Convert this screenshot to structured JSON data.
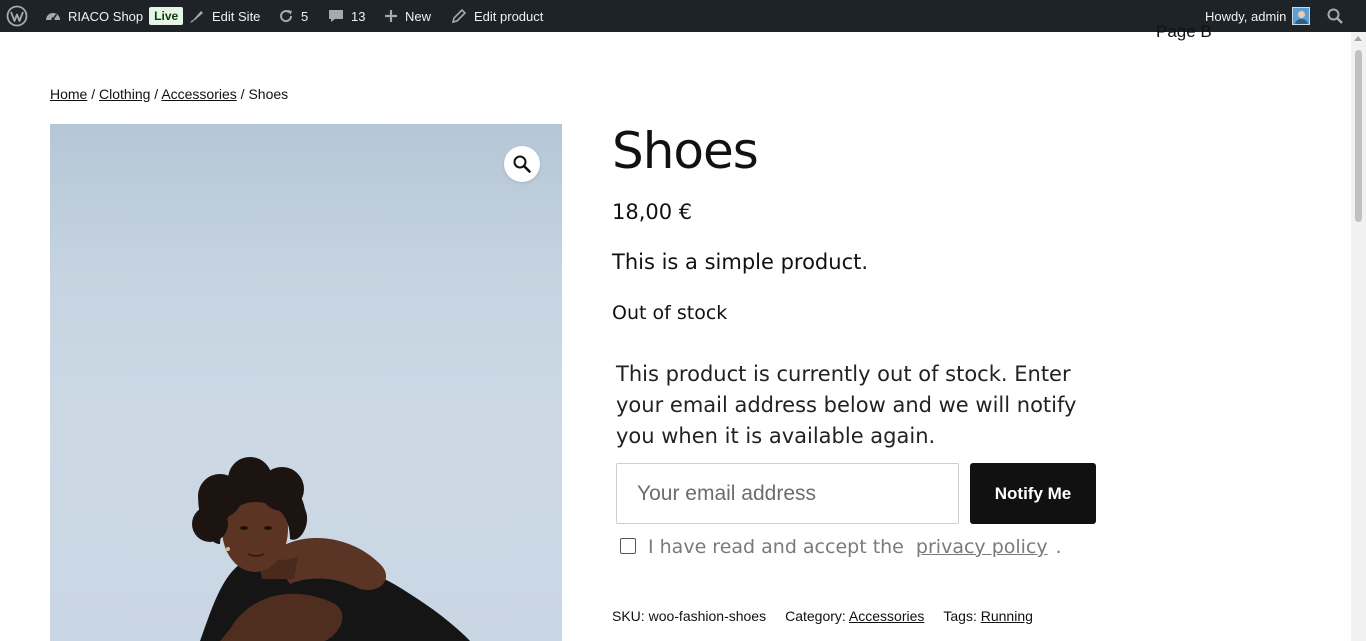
{
  "admin_bar": {
    "site_name": "RIACO Shop",
    "live_badge": "Live",
    "edit_site": "Edit Site",
    "updates_count": "5",
    "comments_count": "13",
    "new_label": "New",
    "edit_product": "Edit product",
    "greeting": "Howdy, admin"
  },
  "header": {
    "page_label": "Page B"
  },
  "breadcrumb": {
    "items": [
      "Home",
      "Clothing",
      "Accessories"
    ],
    "separator": "/",
    "current": "Shoes"
  },
  "product": {
    "title": "Shoes",
    "price": "18,00 €",
    "short_description": "This is a simple product.",
    "stock_status": "Out of stock",
    "notify": {
      "message": "This product is currently out of stock. Enter your email address below and we will notify you when it is available again.",
      "email_placeholder": "Your email address",
      "button_label": "Notify Me",
      "consent_text": "I have read and accept the",
      "privacy_link": "privacy policy",
      "consent_period": "."
    },
    "meta": {
      "sku_label": "SKU:",
      "sku": "woo-fashion-shoes",
      "category_label": "Category:",
      "category": "Accessories",
      "tags_label": "Tags:",
      "tag": "Running"
    }
  },
  "icons": {
    "wordpress": "wordpress-logo-icon",
    "dashboard": "dashboard-gauge-icon",
    "edit_site": "brush-icon",
    "updates": "refresh-icon",
    "comments": "speech-bubble-icon",
    "new": "plus-icon",
    "edit": "pencil-icon",
    "search": "search-icon",
    "zoom": "magnifier-icon"
  },
  "colors": {
    "admin_bar_bg": "#1d2327",
    "button_bg": "#111111",
    "image_bg": "#c6d4e1",
    "live_badge_bg": "#e6f5e6"
  }
}
